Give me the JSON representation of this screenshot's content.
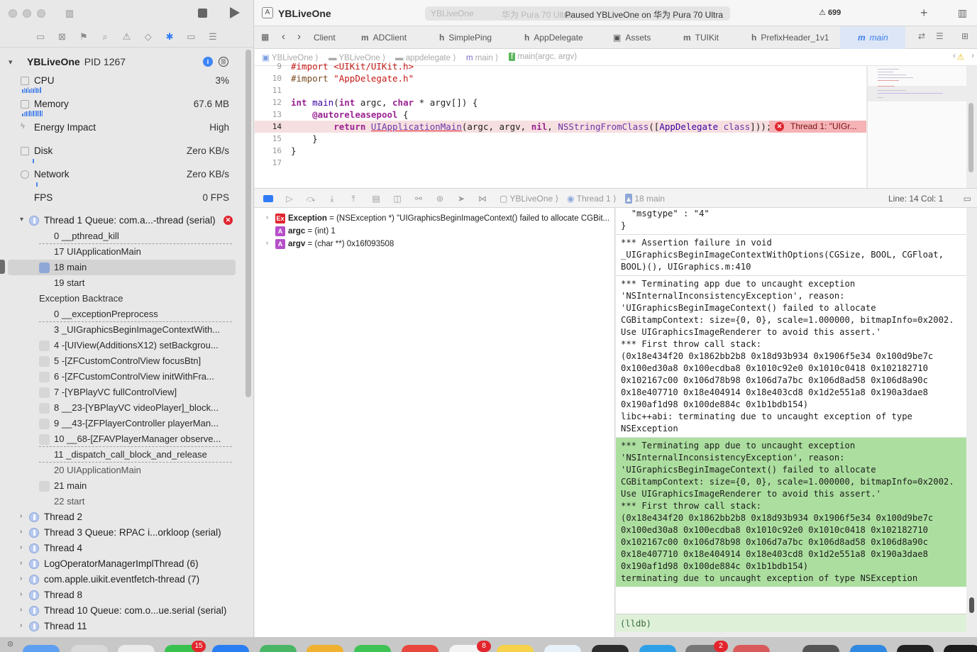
{
  "toolbar": {
    "app_title": "YBLiveOne",
    "scheme_target": "YBLiveOne",
    "scheme_device": "华为 Pura 70 Ultra",
    "status": "Paused YBLiveOne on 华为 Pura 70 Ultra",
    "warnings": "699"
  },
  "tabs": [
    {
      "kind": "",
      "label": "Client"
    },
    {
      "kind": "m",
      "label": "ADClient"
    },
    {
      "kind": "h",
      "label": "SimplePing"
    },
    {
      "kind": "h",
      "label": "AppDelegate"
    },
    {
      "kind": "",
      "label": "Assets"
    },
    {
      "kind": "m",
      "label": "TUIKit"
    },
    {
      "kind": "h",
      "label": "PrefixHeader_1v1"
    },
    {
      "kind": "m",
      "label": "main"
    }
  ],
  "breadcrumb": [
    "YBLiveOne",
    "YBLiveOne",
    "appdelegate",
    "main",
    "main(argc, argv)"
  ],
  "process": {
    "name": "YBLiveOne",
    "pid": "PID 1267"
  },
  "gauges": [
    {
      "label": "CPU",
      "value": "3%"
    },
    {
      "label": "Memory",
      "value": "67.6 MB"
    },
    {
      "label": "Energy Impact",
      "value": "High"
    },
    {
      "label": "Disk",
      "value": "Zero KB/s"
    },
    {
      "label": "Network",
      "value": "Zero KB/s"
    },
    {
      "label": "FPS",
      "value": "0 FPS"
    }
  ],
  "thread1": {
    "label": "Thread 1",
    "queue": "Queue: com.a...-thread (serial)"
  },
  "frames_a": [
    "0 __pthread_kill",
    "17 UIApplicationMain",
    "18 main",
    "19 start"
  ],
  "exception_backtrace_label": "Exception Backtrace",
  "frames_b": [
    "0 __exceptionPreprocess",
    "3 _UIGraphicsBeginImageContextWith...",
    "4 -[UIView(AdditionsX12) setBackgrou...",
    "5 -[ZFCustomControlView focusBtn]",
    "6 -[ZFCustomControlView initWithFra...",
    "7 -[YBPlayVC fullControlView]",
    "8 __23-[YBPlayVC videoPlayer]_block...",
    "9 __43-[ZFPlayerController playerMan...",
    "10 __68-[ZFAVPlayerManager observe...",
    "11 _dispatch_call_block_and_release",
    "20 UIApplicationMain",
    "21 main",
    "22 start"
  ],
  "threads": [
    "Thread 2",
    "Thread 3 Queue: RPAC i...orkloop (serial)",
    "Thread 4",
    "LogOperatorManagerImplThread (6)",
    "com.apple.uikit.eventfetch-thread (7)",
    "Thread 8",
    "Thread 10 Queue: com.o...ue.serial (serial)",
    "Thread 11"
  ],
  "code": {
    "lines": [
      "9",
      "10",
      "11",
      "12",
      "13",
      "14",
      "15",
      "16",
      "17"
    ],
    "line9": "#import <UIKit/UIKit.h>",
    "line10_kw": "#import",
    "line10_str": "\"AppDelegate.h\"",
    "error_text": "Thread 1: \"UIGr..."
  },
  "debugbar": {
    "crumb1": "YBLiveOne",
    "crumb2": "Thread 1",
    "crumb3": "18 main",
    "linecol": "Line: 14  Col: 1"
  },
  "variables": [
    {
      "badge": "Ex",
      "name": "Exception",
      "value": " = (NSException *) \"UIGraphicsBeginImageContext() failed to allocate CGBit..."
    },
    {
      "badge": "A",
      "name": "argc",
      "value": " = (int) 1"
    },
    {
      "badge": "A",
      "name": "argv",
      "value": " = (char **) 0x16f093508"
    }
  ],
  "console": {
    "block0": "  \"msgtype\" : \"4\"\n}",
    "block1": "*** Assertion failure in void _UIGraphicsBeginImageContextWithOptions(CGSize, BOOL, CGFloat, BOOL)(), UIGraphics.m:410",
    "block2": "*** Terminating app due to uncaught exception 'NSInternalInconsistencyException', reason: 'UIGraphicsBeginImageContext() failed to allocate CGBitampContext: size={0, 0}, scale=1.000000, bitmapInfo=0x2002. Use UIGraphicsImageRenderer to avoid this assert.'\n*** First throw call stack:\n(0x18e434f20 0x1862bb2b8 0x18d93b934 0x1906f5e34 0x100d9be7c 0x100ed30a8 0x100ecdba8 0x1010c92e0 0x1010c0418 0x102182710 0x102167c00 0x106d78b98 0x106d7a7bc 0x106d8ad58 0x106d8a90c 0x18e407710 0x18e404914 0x18e403cd8 0x1d2e551a8 0x190a3dae8 0x190af1d98 0x100de884c 0x1b1bdb154)\nlibc++abi: terminating due to uncaught exception of type NSException",
    "block3": "*** Terminating app due to uncaught exception 'NSInternalInconsistencyException', reason: 'UIGraphicsBeginImageContext() failed to allocate CGBitampContext: size={0, 0}, scale=1.000000, bitmapInfo=0x2002. Use UIGraphicsImageRenderer to avoid this assert.'\n*** First throw call stack:\n(0x18e434f20 0x1862bb2b8 0x18d93b934 0x1906f5e34 0x100d9be7c 0x100ed30a8 0x100ecdba8 0x1010c92e0 0x1010c0418 0x102182710 0x102167c00 0x106d78b98 0x106d7a7bc 0x106d8ad58 0x106d8a90c 0x18e407710 0x18e404914 0x18e403cd8 0x1d2e551a8 0x190a3dae8 0x190af1d98 0x100de884c 0x1b1bdb154)\nterminating due to uncaught exception of type NSException",
    "prompt": "(lldb)"
  },
  "dock_badges": [
    "15",
    "8",
    "2"
  ],
  "colors": {
    "accent": "#2f7cf6",
    "error": "#e0252f",
    "current_line": "#f6dfe0",
    "console_highlight": "#acdf9f"
  }
}
